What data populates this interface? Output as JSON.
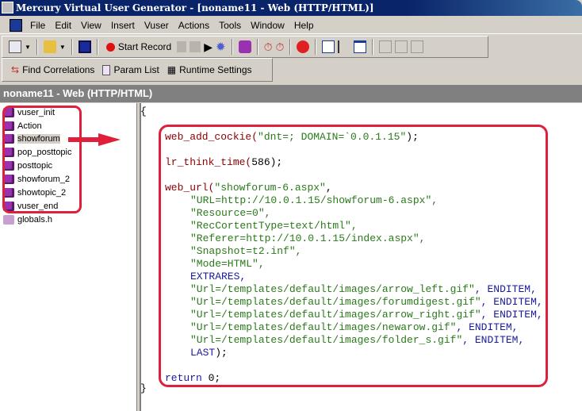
{
  "window": {
    "title": "Mercury Virtual User Generator - [noname11 - Web (HTTP/HTML)]"
  },
  "menu": [
    "File",
    "Edit",
    "View",
    "Insert",
    "Vuser",
    "Actions",
    "Tools",
    "Window",
    "Help"
  ],
  "toolbar": {
    "start_record": "Start Record"
  },
  "toolbar2": {
    "find_correlations": "Find Correlations",
    "param_list": "Param List",
    "runtime_settings": "Runtime Settings"
  },
  "panel": {
    "title": "noname11 - Web (HTTP/HTML)"
  },
  "tree": {
    "items": [
      "vuser_init",
      "Action",
      "showforum",
      "pop_posttopic",
      "posttopic",
      "showforum_2",
      "showtopic_2",
      "vuser_end",
      "globals.h"
    ],
    "selected": "showforum"
  },
  "code": {
    "open": "{",
    "close": "}",
    "l1_fn": "web_add_cockie(",
    "l1_str": "\"dnt=; DOMAIN=`0.0.1.15\"",
    "l1_end": ");",
    "l2_fn": "lr_think_time(",
    "l2_num": "586",
    "l2_end": ");",
    "l3_fn": "web_url(",
    "l3_str": "\"showforum-6.aspx\"",
    "comma": ",",
    "args": [
      "\"URL=http://10.0.1.15/showforum-6.aspx\",",
      "\"Resource=0\",",
      "\"RecCortentType=text/html\",",
      "\"Referer=http://10.0.1.15/index.aspx\",",
      "\"Snapshot=t2.inf\",",
      "\"Mode=HTML\","
    ],
    "extrares": "EXTRARES,",
    "items": [
      "\"Url=/templates/default/images/arrow_left.gif\"",
      "\"Url=/templates/default/images/forumdigest.gif\"",
      "\"Url=/templates/default/images/arrow_right.gif\"",
      "\"Url=/templates/default/images/newarow.gif\"",
      "\"Url=/templates/default/images/folder_s.gif\""
    ],
    "enditem": ", ENDITEM,",
    "last": "LAST",
    "last_end": ");",
    "ret_kw": "return",
    "ret_val": " 0;"
  },
  "colors": {
    "highlight": "#e0203a",
    "title_bg": "#0a246a"
  }
}
